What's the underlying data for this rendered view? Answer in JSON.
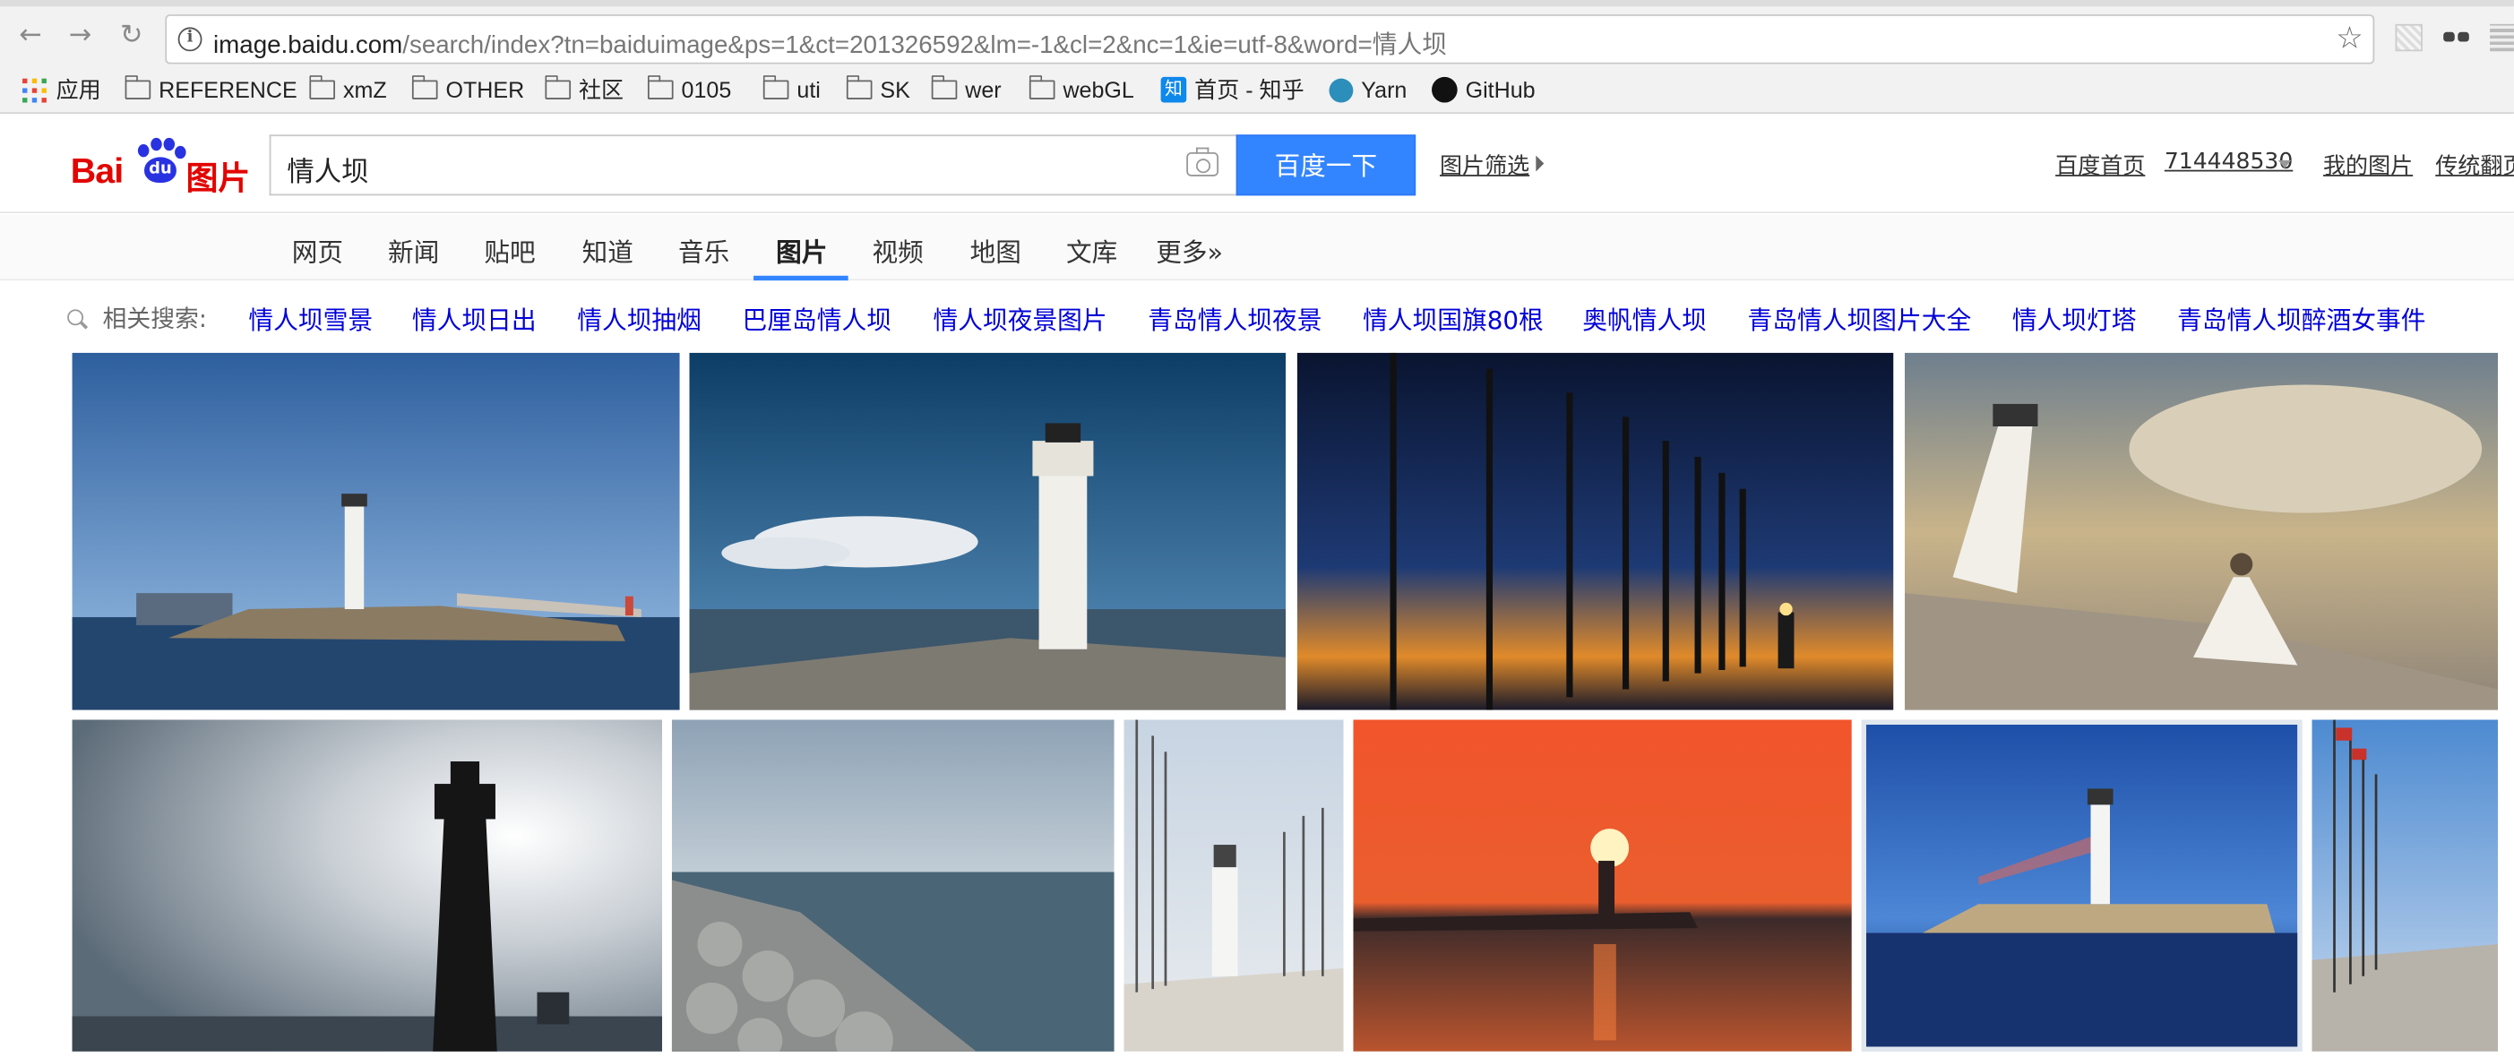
{
  "browser": {
    "url_host": "image.baidu.com",
    "url_rest": "/search/index?tn=baiduimage&ps=1&ct=201326592&lm=-1&cl=2&nc=1&ie=utf-8&word=情人坝"
  },
  "bookmarks": {
    "apps": "应用",
    "items": [
      "REFERENCE",
      "xmZ",
      "OTHER",
      "社区",
      "0105",
      "uti",
      "SK",
      "wer",
      "webGL"
    ],
    "zhihu": "首页 - 知乎",
    "zhihu_icon_text": "知",
    "yarn": "Yarn",
    "github": "GitHub"
  },
  "header": {
    "logo_bai": "Bai",
    "logo_du": "du",
    "logo_tupian": "图片",
    "search_value": "情人坝",
    "search_button": "百度一下",
    "filter_link": "图片筛选",
    "user_links": {
      "home": "百度首页",
      "username": "714448530",
      "my_images": "我的图片",
      "classic": "传统翻页"
    }
  },
  "categories": {
    "items": [
      "网页",
      "新闻",
      "贴吧",
      "知道",
      "音乐",
      "图片",
      "视频",
      "地图",
      "文库",
      "更多»"
    ],
    "active": "图片"
  },
  "related": {
    "label": "相关搜索:",
    "items": [
      "情人坝雪景",
      "情人坝日出",
      "情人坝抽烟",
      "巴厘岛情人坝",
      "情人坝夜景图片",
      "青岛情人坝夜景",
      "情人坝国旗80根",
      "奥帆情人坝",
      "青岛情人坝图片大全",
      "情人坝灯塔",
      "青岛情人坝醉酒女事件"
    ]
  },
  "results": {
    "images": [
      "lighthouse-breakwater",
      "lighthouse-pier-clouds",
      "flagpoles-sunset",
      "bride-lighthouse",
      "lighthouse-silhouette",
      "tetrapod-breakwater",
      "lighthouse-flagpoles",
      "lighthouse-red-sunset",
      "lighthouse-blue-sea",
      "flagpoles-promenade"
    ]
  },
  "colors": {
    "baidu_red": "#e10602",
    "baidu_blue": "#2932e1",
    "search_button": "#3385ff",
    "link_blue": "#0000d8"
  }
}
